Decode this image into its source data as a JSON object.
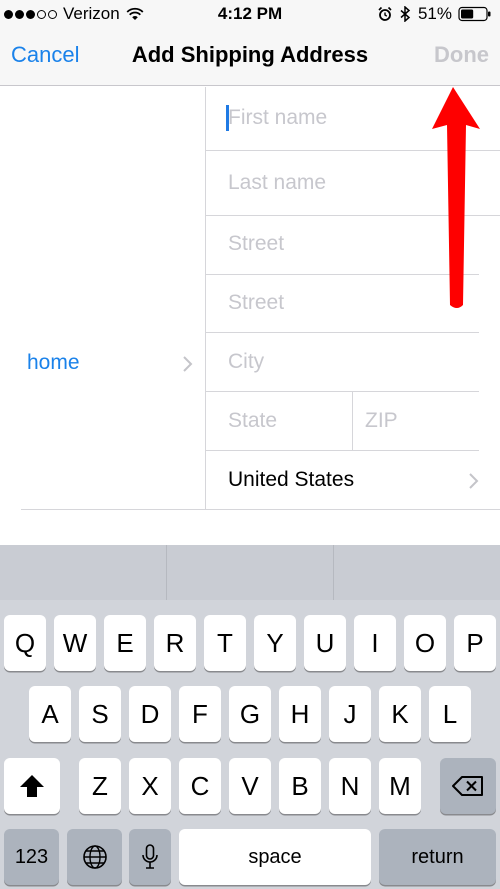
{
  "status_bar": {
    "carrier": "Verizon",
    "signal_bars_filled": 3,
    "signal_bars_total": 5,
    "time": "4:12 PM",
    "battery_percent": "51%",
    "battery_level": 0.51,
    "icons": [
      "wifi-icon",
      "alarm-icon",
      "bluetooth-icon",
      "battery-icon"
    ]
  },
  "nav": {
    "cancel_label": "Cancel",
    "title": "Add Shipping Address",
    "done_label": "Done"
  },
  "form": {
    "first_name_placeholder": "First name",
    "last_name_placeholder": "Last name",
    "street1_placeholder": "Street",
    "street2_placeholder": "Street",
    "city_placeholder": "City",
    "state_placeholder": "State",
    "zip_placeholder": "ZIP",
    "country_value": "United States",
    "address_label": "home"
  },
  "keyboard": {
    "row1": [
      "Q",
      "W",
      "E",
      "R",
      "T",
      "Y",
      "U",
      "I",
      "O",
      "P"
    ],
    "row2": [
      "A",
      "S",
      "D",
      "F",
      "G",
      "H",
      "J",
      "K",
      "L"
    ],
    "row3": [
      "Z",
      "X",
      "C",
      "V",
      "B",
      "N",
      "M"
    ],
    "numbers_label": "123",
    "space_label": "space",
    "return_label": "return",
    "icons": [
      "shift-icon",
      "backspace-icon",
      "globe-icon",
      "microphone-icon"
    ]
  },
  "colors": {
    "accent": "#1a82ea",
    "placeholder": "#c7c7cd",
    "disabled": "#c7c7cc",
    "annotation_arrow": "#ff0000",
    "keyboard_bg": "#d1d4da"
  }
}
